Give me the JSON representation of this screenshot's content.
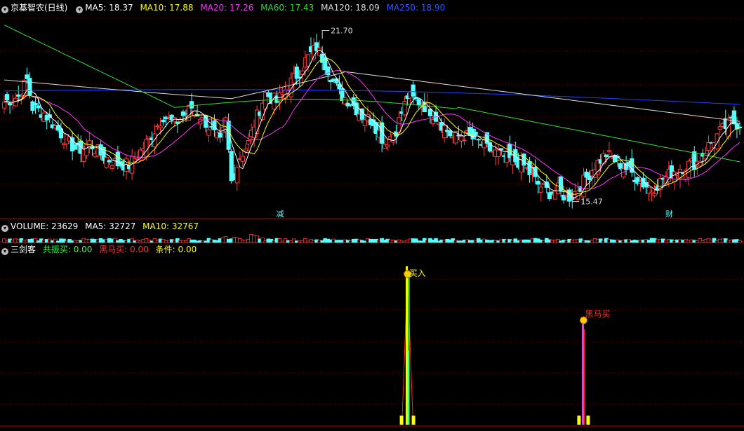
{
  "colors": {
    "up": "#ff3b3b",
    "down": "#54ffff",
    "ma5": "#ffffff",
    "ma10": "#ffff00",
    "ma20": "#ff33ff",
    "ma60": "#33dd33",
    "ma120": "#dddddd",
    "ma250": "#2244ff",
    "grid": "#7a0000"
  },
  "main_legend": {
    "collapse_icon": "chevron-down-icon",
    "stock_name": "京基智农(日线)",
    "ma5": "MA5: 18.37",
    "ma10": "MA10: 17.88",
    "ma20": "MA20: 17.26",
    "ma60": "MA60: 17.43",
    "ma120": "MA120: 18.09",
    "ma250": "MA250: 18.90"
  },
  "volume_legend": {
    "title": "VOLUME: 23629",
    "ma5": "MA5: 32727",
    "ma10": "MA10: 32767"
  },
  "indicator_legend": {
    "title": "三剑客",
    "gongzhen": "共振买: 0.00",
    "heima": "黑马买: 0.00",
    "tiaojian": "条件: 0.00"
  },
  "chart_data": [
    {
      "type": "candlestick",
      "title": "京基智农(日线)",
      "y_range": [
        14.9,
        22.3
      ],
      "high_label": "21.70",
      "low_label": "15.47",
      "markers": [
        {
          "text": "减",
          "x_index": 97
        },
        {
          "text": "财",
          "x_index": 234
        }
      ],
      "series": [
        {
          "name": "MA5",
          "value": 18.37
        },
        {
          "name": "MA10",
          "value": 17.88
        },
        {
          "name": "MA20",
          "value": 17.26
        },
        {
          "name": "MA60",
          "value": 17.43
        },
        {
          "name": "MA120",
          "value": 18.09
        },
        {
          "name": "MA250",
          "value": 18.9
        }
      ],
      "close_keys": [
        [
          0,
          19.1
        ],
        [
          5,
          19.3
        ],
        [
          8,
          19.9
        ],
        [
          10,
          18.9
        ],
        [
          14,
          18.7
        ],
        [
          18,
          18.2
        ],
        [
          22,
          17.7
        ],
        [
          26,
          17.3
        ],
        [
          30,
          17.6
        ],
        [
          35,
          17.1
        ],
        [
          40,
          16.85
        ],
        [
          44,
          16.8
        ],
        [
          48,
          17.3
        ],
        [
          52,
          17.9
        ],
        [
          56,
          18.6
        ],
        [
          60,
          18.3
        ],
        [
          66,
          18.9
        ],
        [
          70,
          18.5
        ],
        [
          76,
          17.6
        ],
        [
          78,
          18.4
        ],
        [
          80,
          16.2
        ],
        [
          83,
          17.1
        ],
        [
          86,
          17.6
        ],
        [
          88,
          18.3
        ],
        [
          92,
          19.4
        ],
        [
          96,
          19.1
        ],
        [
          100,
          19.7
        ],
        [
          104,
          20.2
        ],
        [
          106,
          20.6
        ],
        [
          110,
          21.1
        ],
        [
          114,
          20.3
        ],
        [
          118,
          19.4
        ],
        [
          122,
          19.1
        ],
        [
          126,
          18.6
        ],
        [
          130,
          18.4
        ],
        [
          134,
          17.6
        ],
        [
          138,
          18.1
        ],
        [
          142,
          19.3
        ],
        [
          146,
          19.1
        ],
        [
          150,
          18.8
        ],
        [
          154,
          18.3
        ],
        [
          158,
          17.8
        ],
        [
          162,
          17.9
        ],
        [
          166,
          17.7
        ],
        [
          170,
          17.4
        ],
        [
          174,
          17.2
        ],
        [
          178,
          17.0
        ],
        [
          182,
          16.9
        ],
        [
          185,
          16.5
        ],
        [
          188,
          16.1
        ],
        [
          192,
          15.8
        ],
        [
          195,
          15.9
        ],
        [
          198,
          15.6
        ],
        [
          200,
          15.7
        ],
        [
          204,
          16.2
        ],
        [
          208,
          16.8
        ],
        [
          212,
          17.2
        ],
        [
          216,
          16.9
        ],
        [
          220,
          16.6
        ],
        [
          224,
          16.2
        ],
        [
          228,
          15.9
        ],
        [
          232,
          16.3
        ],
        [
          236,
          16.6
        ],
        [
          240,
          16.8
        ],
        [
          244,
          16.9
        ],
        [
          248,
          17.5
        ],
        [
          252,
          18.0
        ],
        [
          256,
          18.37
        ],
        [
          259,
          18.3
        ]
      ]
    },
    {
      "type": "bar",
      "title": "VOLUME",
      "latest": 23629,
      "ma5": 32727,
      "ma10": 32767
    },
    {
      "type": "signal",
      "title": "三剑客",
      "signals": [
        {
          "label": "买入",
          "x_index": 142
        },
        {
          "label": "黑马买",
          "x_index": 204
        }
      ]
    }
  ]
}
